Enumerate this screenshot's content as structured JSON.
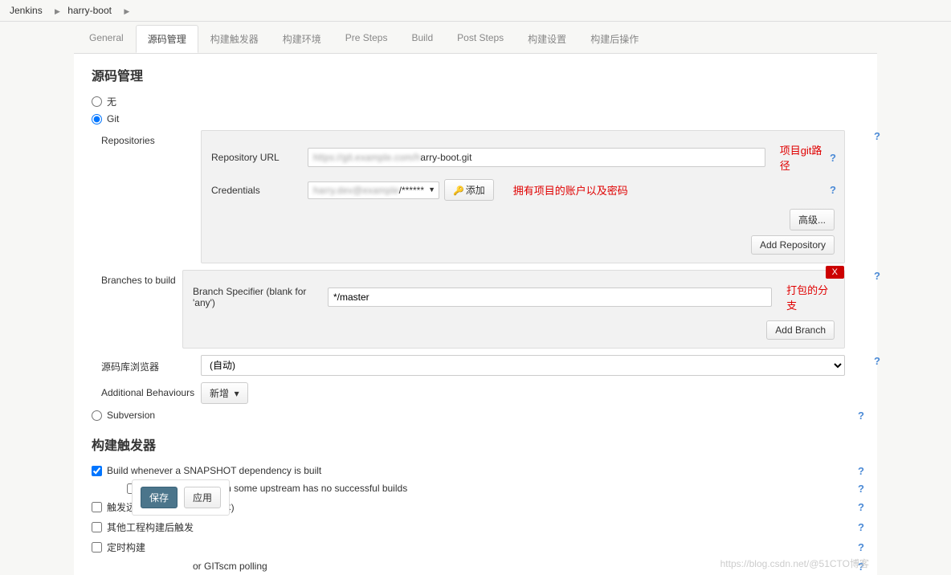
{
  "breadcrumb": {
    "root": "Jenkins",
    "item": "harry-boot"
  },
  "tabs": [
    {
      "key": "general",
      "label": "General"
    },
    {
      "key": "scm",
      "label": "源码管理"
    },
    {
      "key": "trigger",
      "label": "构建触发器"
    },
    {
      "key": "env",
      "label": "构建环境"
    },
    {
      "key": "pre",
      "label": "Pre Steps"
    },
    {
      "key": "build",
      "label": "Build"
    },
    {
      "key": "post",
      "label": "Post Steps"
    },
    {
      "key": "settings",
      "label": "构建设置"
    },
    {
      "key": "postbuild",
      "label": "构建后操作"
    }
  ],
  "activeTab": "scm",
  "scm": {
    "title": "源码管理",
    "options": {
      "none": "无",
      "git": "Git",
      "svn": "Subversion"
    },
    "repo_section_label": "Repositories",
    "repo_url_label": "Repository URL",
    "repo_url_value": "arry-boot.git",
    "repo_url_blur": "https://git.example.com/h",
    "annot_repo": "项目git路径",
    "cred_label": "Credentials",
    "cred_value": "/******",
    "cred_blur": "harry.dev@example",
    "cred_add_btn": "添加",
    "annot_cred": "拥有项目的账户以及密码",
    "advanced_btn": "高级...",
    "add_repo_btn": "Add Repository",
    "branches_label": "Branches to build",
    "branch_spec_label": "Branch Specifier (blank for 'any')",
    "branch_spec_value": "*/master",
    "annot_branch": "打包的分支",
    "add_branch_btn": "Add Branch",
    "browser_label": "源码库浏览器",
    "browser_value": "(自动)",
    "behaviours_label": "Additional Behaviours",
    "behaviours_btn": "新增"
  },
  "triggers": {
    "title": "构建触发器",
    "t1": "Build whenever a SNAPSHOT dependency is built",
    "t1_sub": "Schedule build when some upstream has no successful builds",
    "t2": "触发远程构建 (例如,使用脚本)",
    "t3": "其他工程构建后触发",
    "t4": "定时构建",
    "t5_suffix": "or GITscm polling"
  },
  "buttons": {
    "save": "保存",
    "apply": "应用"
  },
  "watermark": "https://blog.csdn.net/@51CTO博客"
}
